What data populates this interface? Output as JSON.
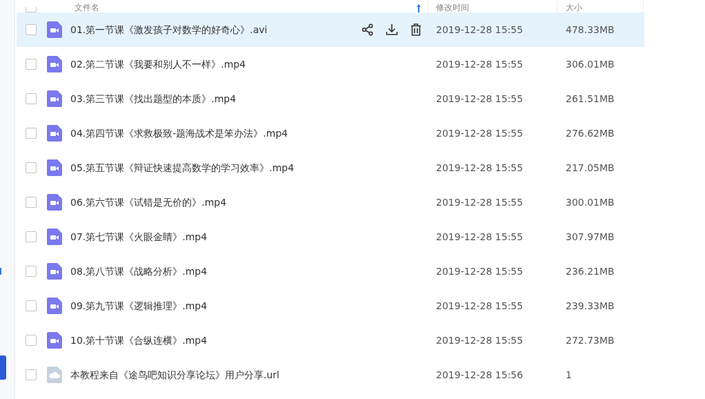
{
  "select_all": {
    "checked": false
  },
  "columns": [
    {
      "label": "文件名",
      "sorted": true
    },
    {
      "label": "修改时间",
      "sorted": false
    },
    {
      "label": "大小",
      "sorted": false
    }
  ],
  "rows": [
    {
      "name": "01.第一节课《激发孩子对数学的好奇心》.avi",
      "date": "2019-12-28 15:55",
      "size": "478.33MB",
      "kind": "video",
      "selected": true,
      "checked": false
    },
    {
      "name": "02.第二节课《我要和别人不一样》.mp4",
      "date": "2019-12-28 15:55",
      "size": "306.01MB",
      "kind": "video",
      "selected": false,
      "checked": false
    },
    {
      "name": "03.第三节课《找出题型的本质》.mp4",
      "date": "2019-12-28 15:55",
      "size": "261.51MB",
      "kind": "video",
      "selected": false,
      "checked": false
    },
    {
      "name": "04.第四节课《求救极致-题海战术是笨办法》.mp4",
      "date": "2019-12-28 15:55",
      "size": "276.62MB",
      "kind": "video",
      "selected": false,
      "checked": false
    },
    {
      "name": "05.第五节课《辩证快速提高数学的学习效率》.mp4",
      "date": "2019-12-28 15:55",
      "size": "217.05MB",
      "kind": "video",
      "selected": false,
      "checked": false
    },
    {
      "name": "06.第六节课《试错是无价的》.mp4",
      "date": "2019-12-28 15:55",
      "size": "300.01MB",
      "kind": "video",
      "selected": false,
      "checked": false
    },
    {
      "name": "07.第七节课《火眼金睛》.mp4",
      "date": "2019-12-28 15:55",
      "size": "307.97MB",
      "kind": "video",
      "selected": false,
      "checked": false
    },
    {
      "name": "08.第八节课《战略分析》.mp4",
      "date": "2019-12-28 15:55",
      "size": "236.21MB",
      "kind": "video",
      "selected": false,
      "checked": false
    },
    {
      "name": "09.第九节课《逻辑推理》.mp4",
      "date": "2019-12-28 15:55",
      "size": "239.33MB",
      "kind": "video",
      "selected": false,
      "checked": false
    },
    {
      "name": "10.第十节课《合纵连横》.mp4",
      "date": "2019-12-28 15:55",
      "size": "272.73MB",
      "kind": "video",
      "selected": false,
      "checked": false
    },
    {
      "name": "本教程来自《途鸟吧知识分享论坛》用户分享.url",
      "date": "2019-12-28 15:56",
      "size": "1",
      "kind": "link",
      "selected": false,
      "checked": false
    }
  ]
}
